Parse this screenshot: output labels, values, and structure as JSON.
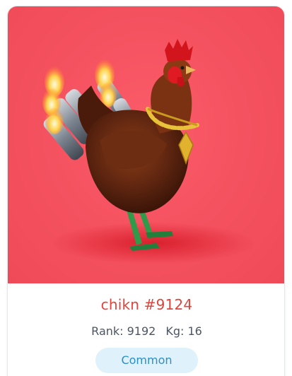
{
  "nft": {
    "name": "chikn #9124",
    "rank": "Rank: 9192",
    "kg": "Kg: 16",
    "rarity": "Common"
  },
  "colors": {
    "background": "#f4515f",
    "name_text": "#e0443c",
    "badge_bg": "#dff1fb",
    "badge_text": "#2b8fca"
  },
  "icons": {
    "artwork": "rooster-with-jet-exhausts-and-gold-chain"
  }
}
